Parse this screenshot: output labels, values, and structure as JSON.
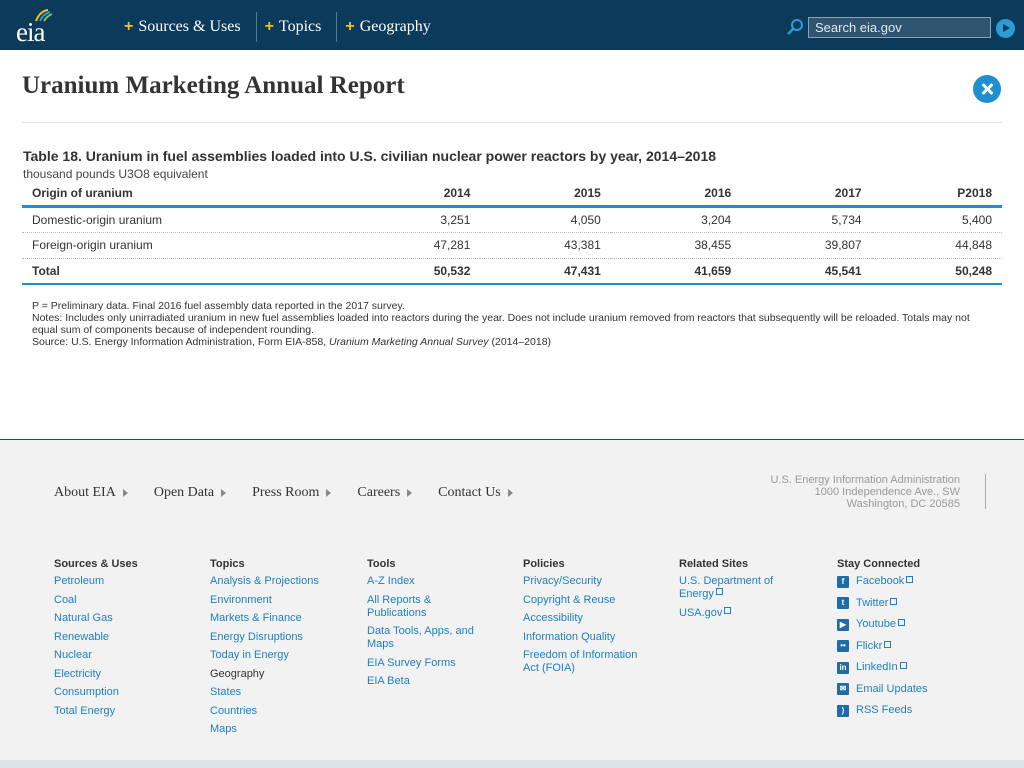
{
  "header": {
    "logo_text": "eia",
    "nav": [
      "Sources & Uses",
      "Topics",
      "Geography"
    ],
    "search_placeholder": "Search eia.gov"
  },
  "page": {
    "title": "Uranium Marketing Annual Report"
  },
  "table": {
    "title": "Table 18. Uranium in fuel assemblies loaded into U.S. civilian nuclear power reactors by year, 2014–2018",
    "unit": "thousand pounds U3O8 equivalent",
    "columns": [
      "Origin of uranium",
      "2014",
      "2015",
      "2016",
      "2017",
      "P2018"
    ],
    "rows": [
      [
        "Domestic-origin uranium",
        "3,251",
        "4,050",
        "3,204",
        "5,734",
        "5,400"
      ],
      [
        "Foreign-origin uranium",
        "47,281",
        "43,381",
        "38,455",
        "39,807",
        "44,848"
      ],
      [
        "Total",
        "50,532",
        "47,431",
        "41,659",
        "45,541",
        "50,248"
      ]
    ],
    "notes": {
      "preliminary": "P = Preliminary data. Final 2016 fuel assembly data reported in the 2017 survey.",
      "notes": "Notes: Includes only unirradiated uranium in new fuel assemblies loaded into reactors during the year. Does not include uranium removed from reactors that subsequently will be reloaded. Totals may not equal sum of components because of independent rounding.",
      "source_prefix": "Source: U.S. Energy Information Administration, Form EIA-858, ",
      "source_title": "Uranium Marketing Annual Survey",
      "source_suffix": " (2014–2018)"
    }
  },
  "footer": {
    "nav": [
      "About EIA",
      "Open Data",
      "Press Room",
      "Careers",
      "Contact Us"
    ],
    "address": [
      "U.S. Energy Information Administration",
      "1000 Independence Ave., SW",
      "Washington, DC 20585"
    ],
    "columns": {
      "sources": {
        "heading": "Sources & Uses",
        "links": [
          "Petroleum",
          "Coal",
          "Natural Gas",
          "Renewable",
          "Nuclear",
          "Electricity",
          "Consumption",
          "Total Energy"
        ]
      },
      "topics": {
        "heading": "Topics",
        "links": [
          "Analysis & Projections",
          "Environment",
          "Markets & Finance",
          "Energy Disruptions",
          "Today in Energy"
        ],
        "sub_heading": "Geography",
        "sub_links": [
          "States",
          "Countries",
          "Maps"
        ]
      },
      "tools": {
        "heading": "Tools",
        "links": [
          "A-Z Index",
          "All Reports & Publications",
          "Data Tools, Apps, and Maps",
          "EIA Survey Forms",
          "EIA Beta"
        ]
      },
      "policies": {
        "heading": "Policies",
        "links": [
          "Privacy/Security",
          "Copyright & Reuse",
          "Accessibility",
          "Information Quality",
          "Freedom of Information Act (FOIA)"
        ]
      },
      "related": {
        "heading": "Related Sites",
        "links": [
          "U.S. Department of Energy",
          "USA.gov"
        ]
      },
      "social": {
        "heading": "Stay Connected",
        "links": [
          "Facebook",
          "Twitter",
          "Youtube",
          "Flickr",
          "LinkedIn",
          "Email Updates",
          "RSS Feeds"
        ]
      }
    }
  },
  "colors": {
    "header_bg": "#0b3a5a",
    "accent": "#1f8fcf",
    "link": "#1f7fc0",
    "plus": "#f0c419"
  }
}
